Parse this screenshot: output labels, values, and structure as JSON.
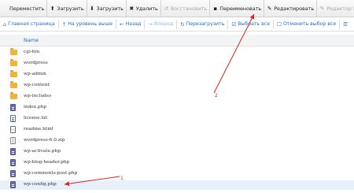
{
  "toolbar": {
    "items": [
      {
        "label": "Переместить",
        "icon": "move-icon",
        "glyph": "",
        "disabled": false
      },
      {
        "label": "Загрузить",
        "icon": "upload-icon",
        "glyph": "⬆",
        "disabled": false
      },
      {
        "label": "Загрузить",
        "icon": "download-icon",
        "glyph": "⬇",
        "disabled": false
      },
      {
        "label": "Удалить",
        "icon": "delete-icon",
        "glyph": "✖",
        "disabled": false
      },
      {
        "label": "Восстановить",
        "icon": "restore-icon",
        "glyph": "↺",
        "disabled": true
      },
      {
        "label": "Переименовать",
        "icon": "rename-icon",
        "glyph": "▪",
        "disabled": false
      },
      {
        "label": "Редактировать",
        "icon": "edit-icon",
        "glyph": "✎",
        "disabled": false
      },
      {
        "label": "Редактор HTML",
        "icon": "html-editor-icon",
        "glyph": "✎",
        "disabled": true
      },
      {
        "label": "",
        "icon": "open-icon",
        "glyph": "⧉",
        "disabled": true
      }
    ]
  },
  "nav": {
    "items": [
      {
        "label": "Главная страница",
        "icon": "home-icon",
        "glyph": "⌂",
        "disabled": false
      },
      {
        "label": "На уровень выше",
        "icon": "level-up-icon",
        "glyph": "↑",
        "disabled": false
      },
      {
        "label": "Назад",
        "icon": "back-icon",
        "glyph": "←",
        "disabled": false
      },
      {
        "label": "Вперед",
        "icon": "forward-icon",
        "glyph": "→",
        "disabled": true
      },
      {
        "label": "Перезагрузить",
        "icon": "reload-icon",
        "glyph": "↻",
        "disabled": false
      },
      {
        "label": "Выбрать все",
        "icon": "select-all-icon",
        "glyph": "☑",
        "disabled": false
      },
      {
        "label": "Отменить выбор все",
        "icon": "deselect-all-icon",
        "glyph": "☐",
        "disabled": false
      },
      {
        "label": "",
        "icon": "view-icon",
        "glyph": "☰",
        "disabled": false
      }
    ]
  },
  "list": {
    "column_header": "Name",
    "files": [
      {
        "name": "cgi-bin",
        "type": "folder"
      },
      {
        "name": "wordpress",
        "type": "folder"
      },
      {
        "name": "wp-admin",
        "type": "folder"
      },
      {
        "name": "wp-content",
        "type": "folder"
      },
      {
        "name": "wp-includes",
        "type": "folder"
      },
      {
        "name": "index.php",
        "type": "php"
      },
      {
        "name": "license.txt",
        "type": "txt"
      },
      {
        "name": "readme.html",
        "type": "html"
      },
      {
        "name": "wordpress-6.0.zip",
        "type": "zip"
      },
      {
        "name": "wp-activate.php",
        "type": "php"
      },
      {
        "name": "wp-blog-header.php",
        "type": "php"
      },
      {
        "name": "wp-comments-post.php",
        "type": "php"
      },
      {
        "name": "wp-config.php",
        "type": "php",
        "selected": true
      }
    ]
  },
  "annotations": {
    "label_1": "1",
    "label_2": "2",
    "color": "#d8261c"
  }
}
